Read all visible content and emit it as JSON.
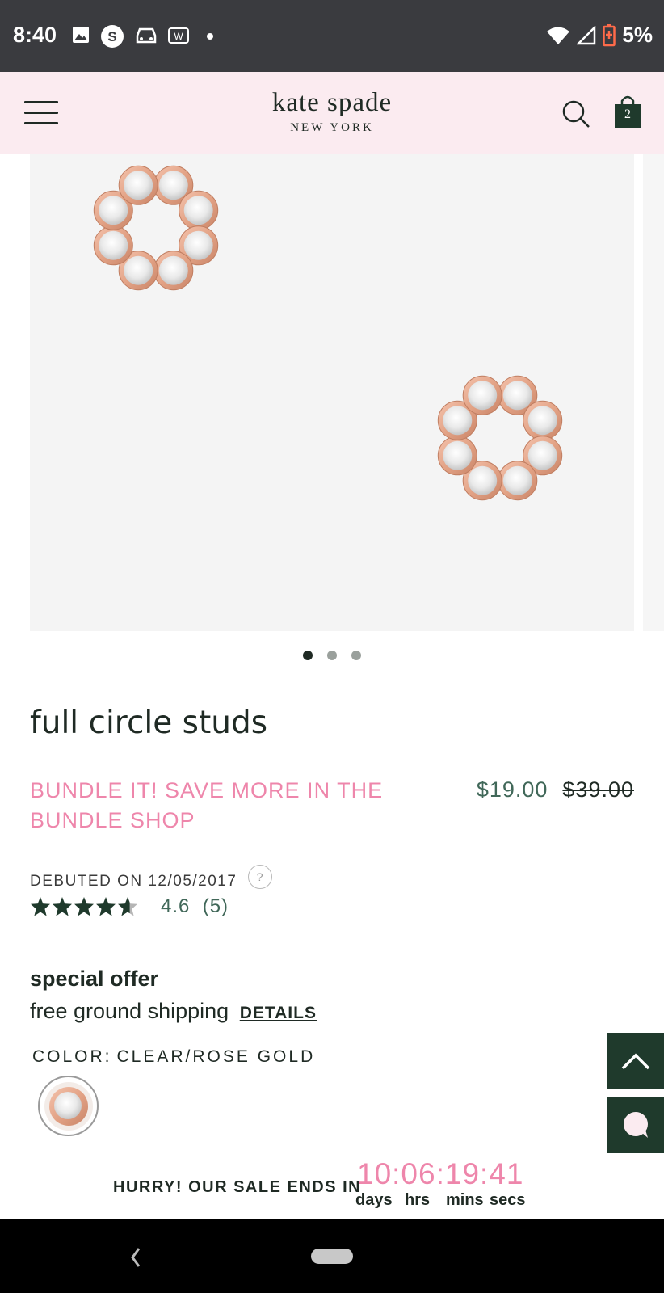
{
  "status_bar": {
    "time": "8:40",
    "battery": "5%",
    "icons": [
      "image-icon",
      "s-app-icon",
      "car-icon",
      "w-app-icon",
      "dot-icon",
      "wifi-icon",
      "signal-icon",
      "battery-low-icon"
    ]
  },
  "header": {
    "brand": "kate spade",
    "brand_sub": "NEW YORK",
    "bag_count": "2",
    "icons": [
      "menu-icon",
      "search-icon",
      "shopping-bag-icon"
    ],
    "background": "#fbebf0"
  },
  "gallery": {
    "slide_count": 3,
    "active_index": 0
  },
  "product": {
    "title": "full circle studs",
    "promo": "BUNDLE IT! SAVE MORE IN THE BUNDLE SHOP",
    "sale_price": "$19.00",
    "original_price": "$39.00",
    "debuted": "DEBUTED ON 12/05/2017",
    "help_icon": "?",
    "rating_value": 4.6,
    "rating_text": "4.6",
    "review_count": "(5)"
  },
  "offer": {
    "heading": "special offer",
    "text": "free ground shipping",
    "details_link": "DETAILS"
  },
  "color": {
    "label": "COLOR:",
    "value": "CLEAR/ROSE GOLD"
  },
  "countdown": {
    "label": "HURRY! OUR SALE ENDS IN",
    "value": "10:06:19:41",
    "units": [
      "days",
      "hrs",
      "mins",
      "secs"
    ]
  },
  "colors": {
    "accent_pink": "#ee86ab",
    "price_green": "#416859",
    "fab_green": "#1f3a2c",
    "rose_gold": "#e8a98f"
  }
}
